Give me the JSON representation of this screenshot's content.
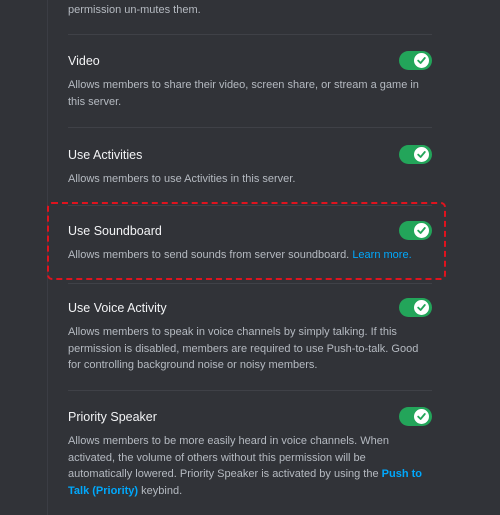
{
  "top_description": "permission un-mutes them.",
  "permissions": [
    {
      "title": "Video",
      "description": "Allows members to share their video, screen share, or stream a game in this server.",
      "enabled": true
    },
    {
      "title": "Use Activities",
      "description": "Allows members to use Activities in this server.",
      "enabled": true
    },
    {
      "title": "Use Soundboard",
      "description": "Allows members to send sounds from server soundboard.",
      "link": "Learn more.",
      "enabled": true,
      "highlighted": true
    },
    {
      "title": "Use Voice Activity",
      "description": "Allows members to speak in voice channels by simply talking. If this permission is disabled, members are required to use Push-to-talk. Good for controlling background noise or noisy members.",
      "enabled": true
    },
    {
      "title": "Priority Speaker",
      "description": "Allows members to be more easily heard in voice channels. When activated, the volume of others without this permission will be automatically lowered. Priority Speaker is activated by using the",
      "link": "Push to Talk (Priority)",
      "description_suffix": "keybind.",
      "enabled": true
    }
  ],
  "colors": {
    "background": "#313338",
    "toggle_on": "#23a55a",
    "link": "#00a8fc",
    "highlight_border": "#e0131e"
  },
  "icons": {
    "toggle_knob": "check-icon"
  }
}
